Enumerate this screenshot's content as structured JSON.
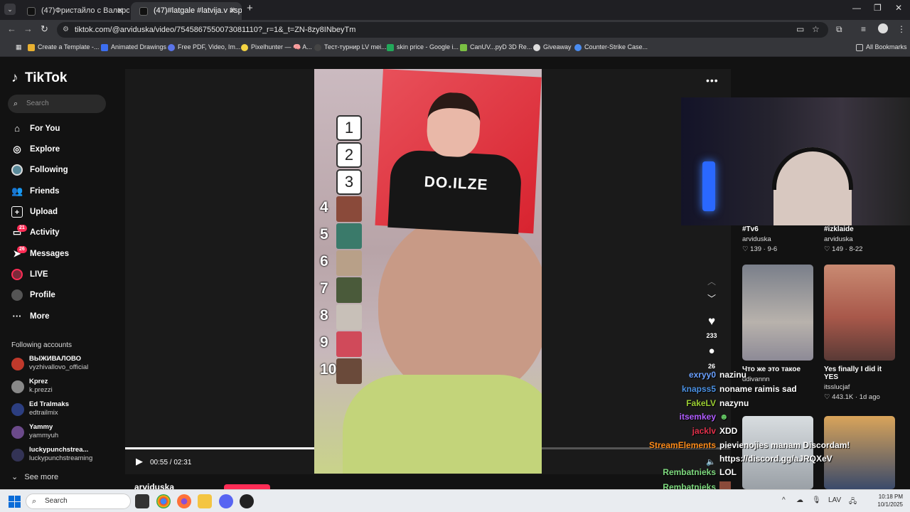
{
  "browser": {
    "tabs": [
      {
        "title": "(47)Фристайло с Валерой: Нор",
        "active": false
      },
      {
        "title": "(47)#latgale #latvija.v #spēle |",
        "active": true
      }
    ],
    "url": "tiktok.com/@arviduska/video/7545867550073081110?_r=1&_t=ZN-8zy8INbeyTm",
    "bookmarks": [
      "Create a Template -...",
      "Animated Drawings",
      "Free PDF, Video, Im...",
      "Pixelhunter — 🧠 A...",
      "Тест-турнир LV mei...",
      "skin price - Google i...",
      "CanUV...pyD 3D Re...",
      "Giveaway",
      "Counter-Strike Case..."
    ],
    "all_bookmarks": "All Bookmarks"
  },
  "tiktok": {
    "logo": "TikTok",
    "search_placeholder": "Search",
    "nav": [
      {
        "label": "For You",
        "icon": "home-icon"
      },
      {
        "label": "Explore",
        "icon": "compass-icon"
      },
      {
        "label": "Following",
        "icon": "avatar-icon"
      },
      {
        "label": "Friends",
        "icon": "friends-icon"
      },
      {
        "label": "Upload",
        "icon": "upload-icon"
      },
      {
        "label": "Activity",
        "icon": "activity-icon",
        "badge": "21"
      },
      {
        "label": "Messages",
        "icon": "messages-icon",
        "badge": "26"
      },
      {
        "label": "LIVE",
        "icon": "live-icon"
      },
      {
        "label": "Profile",
        "icon": "profile-icon"
      },
      {
        "label": "More",
        "icon": "more-icon"
      }
    ],
    "following_title": "Following accounts",
    "following": [
      {
        "name": "ВЫЖИВАЛОВО",
        "handle": "vyzhivallovo_official",
        "color": "#c0392b"
      },
      {
        "name": "Kprez",
        "handle": "k.prezzi",
        "color": "#888888"
      },
      {
        "name": "Ed Tralmaks",
        "handle": "edtrailmix",
        "color": "#2c3e80"
      },
      {
        "name": "Yammy",
        "handle": "yammyuh",
        "color": "#6b4a8a"
      },
      {
        "name": "luckypunchstrea...",
        "handle": "luckypunchstreaming",
        "color": "#333355"
      }
    ],
    "see_more": "See more"
  },
  "video": {
    "time": "00:55 / 02:31",
    "progress": 0.364,
    "poster_text": "DO.ILZE",
    "ranks": [
      "1",
      "2",
      "3",
      "4",
      "5",
      "6",
      "7",
      "8",
      "9",
      "10"
    ],
    "likes": "233",
    "comments": "26",
    "creator": "arviduska"
  },
  "chat": [
    {
      "user": "exryy0",
      "msg": "nazinu",
      "color": "#6aa0ff"
    },
    {
      "user": "knapss5",
      "msg": "noname raimis sad",
      "color": "#4a90e2"
    },
    {
      "user": "FakeLV",
      "msg": "nazynu",
      "color": "#9acd32"
    },
    {
      "user": "itsemkey",
      "msg": "",
      "color": "#b05cff"
    },
    {
      "user": "jacklv",
      "msg": "XDD",
      "color": "#e0304a"
    },
    {
      "user": "StreamElements",
      "msg": "pievienojies manam Discordam!",
      "color": "#ff8c1a"
    },
    {
      "user": "",
      "msg": "https://discord.gg/aJRQXeV",
      "color": "#ffffff"
    },
    {
      "user": "Rembatnieks",
      "msg": "LOL",
      "color": "#7dd87d"
    },
    {
      "user": "Rembatnieks",
      "msg": "",
      "color": "#7dd87d"
    }
  ],
  "related": [
    {
      "title": "#Tv6",
      "user": "arviduska",
      "stats": "♡ 139 · 9-6"
    },
    {
      "title": "#izklaide",
      "user": "arviduska",
      "stats": "♡ 149 · 8-22"
    },
    {
      "title": "Что же это такое",
      "user": "ddivannn",
      "stats": ""
    },
    {
      "title": "Yes finally I did it YES",
      "user": "itsslucjaf",
      "stats": "♡ 443.1K · 1d ago"
    }
  ],
  "taskbar": {
    "search": "Search",
    "lang": "LAV",
    "time": "10:18 PM",
    "date": "10/1/2025"
  }
}
